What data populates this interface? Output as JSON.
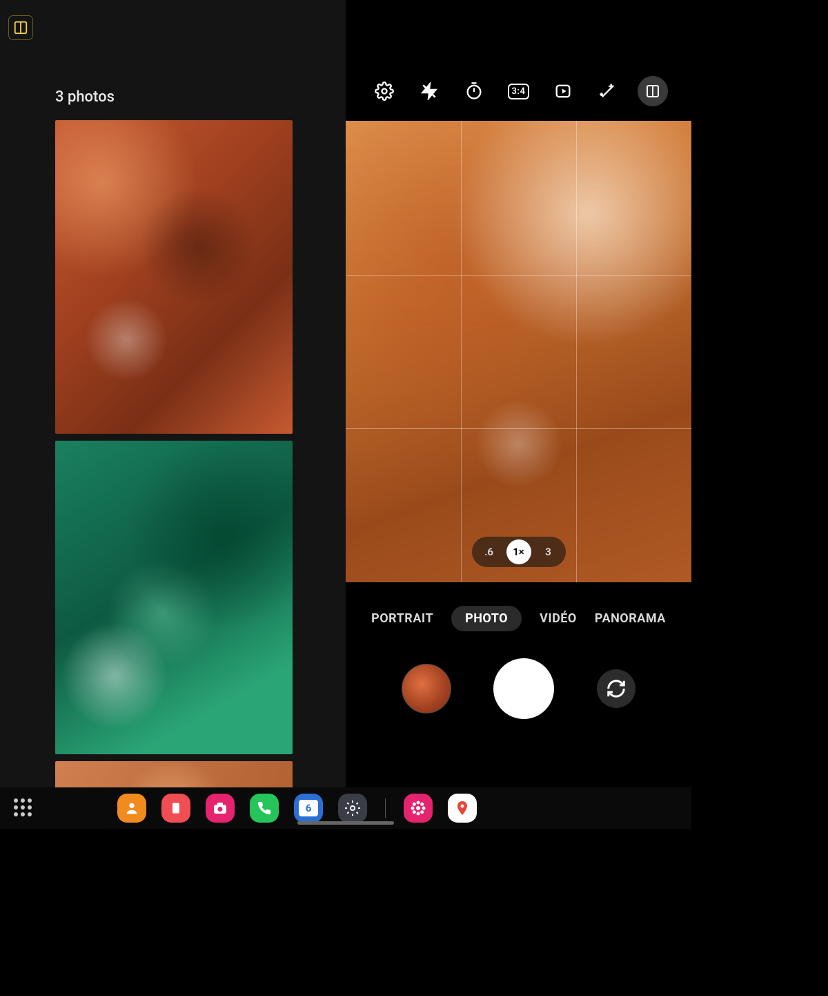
{
  "gallery": {
    "count_label": "3 photos",
    "thumbs": [
      "orange-bricks",
      "green-bricks",
      "orange-bricks-2"
    ]
  },
  "camera": {
    "toolbar": {
      "settings": "settings",
      "flash": "flash-off",
      "timer": "timer",
      "ratio_label": "3:4",
      "motion": "motion-photo",
      "effects": "effects",
      "split": "split-view"
    },
    "zoom": {
      "options": [
        ".6",
        "1×",
        "3"
      ],
      "selected_index": 1
    },
    "modes": {
      "items": [
        "PORTRAIT",
        "PHOTO",
        "VIDÉO",
        "PANORAMA"
      ],
      "selected_index": 1
    }
  },
  "taskbar": {
    "apps": [
      {
        "name": "contacts",
        "bg": "#f28b1e",
        "glyph": "👤"
      },
      {
        "name": "notes",
        "bg": "#f04e53",
        "glyph": "▮"
      },
      {
        "name": "camera",
        "bg": "#e5236e",
        "glyph": "●"
      },
      {
        "name": "phone",
        "bg": "#26c45a",
        "glyph": "📞"
      },
      {
        "name": "calendar",
        "bg": "#2a6fd6",
        "glyph": "6"
      },
      {
        "name": "settings",
        "bg": "#3a3d46",
        "glyph": "⚙"
      }
    ],
    "apps2": [
      {
        "name": "gallery-app",
        "bg": "#e5236e",
        "glyph": "✱"
      },
      {
        "name": "maps",
        "bg": "#ffffff",
        "glyph": "📍"
      }
    ]
  }
}
